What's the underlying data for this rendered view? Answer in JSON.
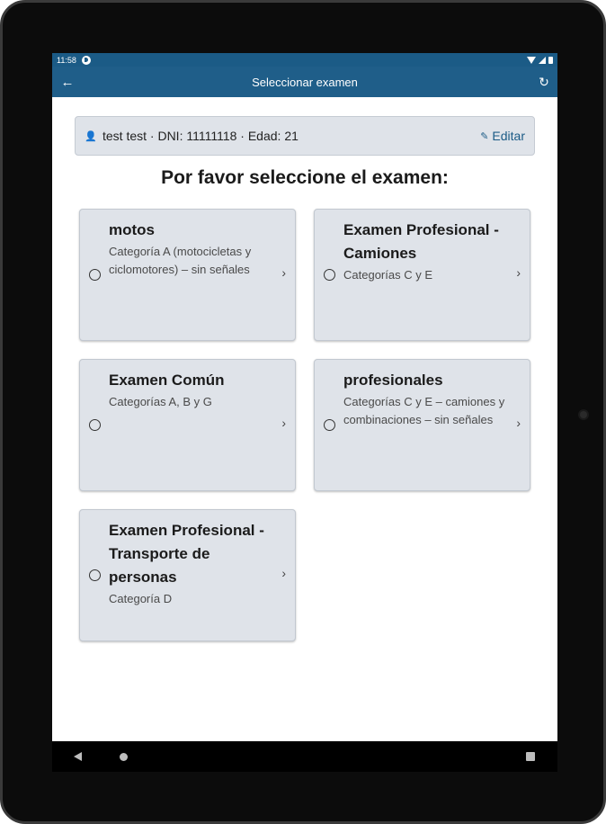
{
  "status": {
    "time": "11:58"
  },
  "appbar": {
    "title": "Seleccionar examen"
  },
  "user": {
    "info": "test test · DNI: 11111118 · Edad: 21",
    "edit_label": "Editar"
  },
  "heading": "Por favor seleccione el examen:",
  "exams": [
    {
      "title": "motos",
      "subtitle": "Categoría A (motocicletas y ciclomotores) – sin señales"
    },
    {
      "title": "Examen Profesional - Camiones",
      "subtitle": "Categorías C y E"
    },
    {
      "title": "Examen Común",
      "subtitle": "Categorías A, B y G"
    },
    {
      "title": "profesionales",
      "subtitle": "Categorías C y E – camiones y combinaciones – sin señales"
    },
    {
      "title": "Examen Profesional - Transporte de personas",
      "subtitle": "Categoría D"
    }
  ],
  "colors": {
    "appbar": "#1f5e89",
    "card": "#dfe3e9",
    "accent": "#1b5b86"
  }
}
